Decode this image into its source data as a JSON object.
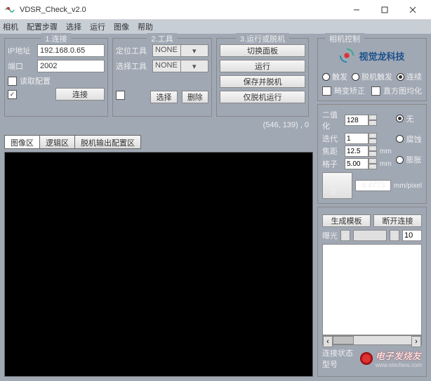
{
  "window": {
    "title": "VDSR_Check_v2.0",
    "minimize": "−",
    "maximize": "☐",
    "close": "✕"
  },
  "menu": [
    "相机",
    "配置步骤",
    "选择",
    "运行",
    "图像",
    "帮助"
  ],
  "group1": {
    "legend": "1.连接",
    "ip_label": "IP地址",
    "ip": "192.168.0.65",
    "port_label": "端口",
    "port": "2002",
    "read_config": "读取配置",
    "connect": "连接"
  },
  "group2": {
    "legend": "2.工具",
    "locate_label": "定位工具",
    "select_label": "选择工具",
    "none": "NONE",
    "choose": "选择",
    "delete": "删除"
  },
  "group3": {
    "legend": "3.运行或脱机",
    "switch": "切换面板",
    "run": "运行",
    "save_offline": "保存并脱机",
    "offline_only": "仅脱机运行"
  },
  "status_text": "(546, 139) , 0",
  "tabs": {
    "image": "图像区",
    "logic": "逻辑区",
    "offline": "脱机输出配置区"
  },
  "right": {
    "legend": "相机控制",
    "logo_text": "视觉龙科技"
  },
  "modes": {
    "trigger": "触发",
    "offline_trigger": "脱机触发",
    "continuous": "连续"
  },
  "checks": {
    "distort": "畸变矫正",
    "histeq": "直方图均化"
  },
  "params": {
    "binarize_label": "二值化",
    "binarize": "128",
    "iter_label": "迭代",
    "iter": "1",
    "focal_label": "焦距",
    "focal": "12.5",
    "grid_label": "格子",
    "grid": "5.00",
    "mm": "mm"
  },
  "morph": {
    "none": "无",
    "erode": "腐蚀",
    "dilate": "膨胀"
  },
  "calib": {
    "btn": "标定",
    "value": "4.4773",
    "unit": "mm/pixel"
  },
  "ctrl": {
    "gen_template": "生成模板",
    "disconnect": "断开连接"
  },
  "exposure": {
    "label": "曝光",
    "value": "10"
  },
  "footer": {
    "conn_state": "连接状态",
    "model": "型号",
    "watermark": "电子发烧友",
    "watermark_url": "www.elecfans.com"
  }
}
